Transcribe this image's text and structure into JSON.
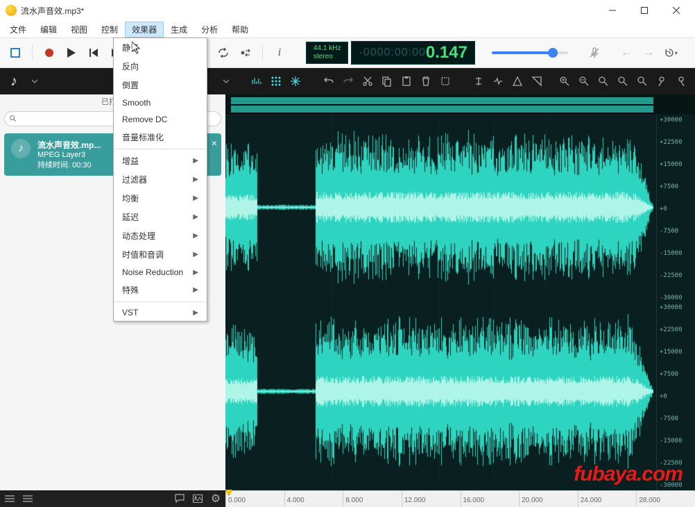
{
  "appTitle": "流水声音效.mp3*",
  "menus": [
    "文件",
    "编辑",
    "视图",
    "控制",
    "效果器",
    "生成",
    "分析",
    "帮助"
  ],
  "activeMenu": "效果器",
  "dropdown": {
    "flat": [
      "静音",
      "反向",
      "倒置",
      "Smooth",
      "Remove DC",
      "音量标准化"
    ],
    "sub": [
      "增益",
      "过滤器",
      "均衡",
      "延迟",
      "动态处理",
      "时值和音调",
      "Noise Reduction",
      "特殊"
    ],
    "after": [
      "VST"
    ]
  },
  "sampleInfo": {
    "rate": "44.1 kHz",
    "mode": "stereo"
  },
  "timecode": {
    "neg": "-0000:00:00",
    "main": "0.147"
  },
  "sidebar": {
    "header": "已打开",
    "searchPlaceholder": "",
    "file": {
      "name": "流水声音效.mp...",
      "codec": "MPEG Layer3",
      "duration": "持续时间: 00:30"
    }
  },
  "yTicks": [
    "+30000",
    "+22500",
    "+15000",
    "+7500",
    "+0",
    "-7500",
    "-15000",
    "-22500",
    "-30000"
  ],
  "timeTicks": [
    "0.000",
    "4.000",
    "8.000",
    "12.000",
    "16.000",
    "20.000",
    "24.000",
    "28.000"
  ],
  "watermark": "fubaya.com",
  "toolbarIcons": [
    "stop",
    "record",
    "play",
    "prev",
    "next",
    "rewind"
  ],
  "navIcons": [
    "loop",
    "repeat-swap",
    "info"
  ],
  "rightIcons": [
    "mic-mute",
    "undo-nav",
    "redo-nav",
    "history"
  ]
}
